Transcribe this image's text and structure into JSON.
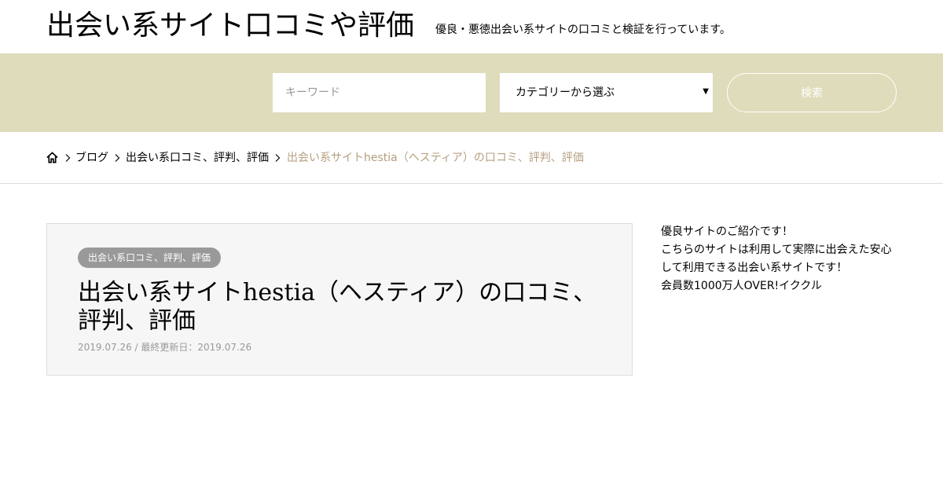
{
  "header": {
    "site_title": "出会い系サイト口コミや評価",
    "site_description": "優良・悪徳出会い系サイトの口コミと検証を行っています。"
  },
  "search": {
    "keyword_placeholder": "キーワード",
    "category_label": "カテゴリーから選ぶ",
    "button_label": "検索"
  },
  "breadcrumb": {
    "items": [
      {
        "label": "ブログ"
      },
      {
        "label": "出会い系口コミ、評判、評価"
      },
      {
        "label": "出会い系サイトhestia（ヘスティア）の口コミ、評判、評価"
      }
    ]
  },
  "article": {
    "category": "出会い系口コミ、評判、評価",
    "title": "出会い系サイトhestia（ヘスティア）の口コミ、評判、評価",
    "published": "2019.07.26",
    "date_separator": " / ",
    "updated_label": "最終更新日：",
    "updated": "2019.07.26"
  },
  "sidebar": {
    "lines": [
      "優良サイトのご紹介です！",
      "こちらのサイトは利用して実際に出会えた安心",
      "して利用できる出会い系サイトです！",
      "会員数1000万人OVER!イククル"
    ]
  },
  "colors": {
    "search_band": "#dedcba",
    "breadcrumb_current": "#b59f80",
    "badge": "#999999",
    "card_background": "#f6f6f6"
  },
  "icons": {
    "home": "home-icon",
    "separator": "chevron-right-icon",
    "select_arrow": "caret-down-icon"
  }
}
